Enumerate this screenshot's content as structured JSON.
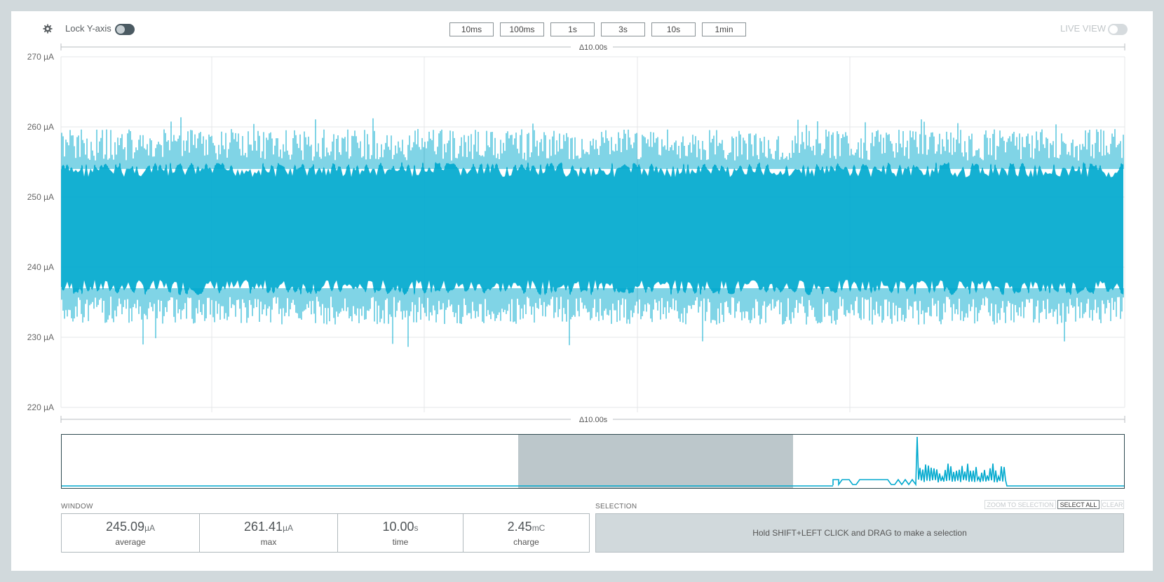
{
  "toolbar": {
    "lock_label": "Lock Y-axis",
    "live_label": "LIVE VIEW",
    "window_buttons": [
      "10ms",
      "100ms",
      "1s",
      "3s",
      "10s",
      "1min"
    ]
  },
  "chart_data": {
    "type": "line",
    "ylim": [
      220,
      270
    ],
    "y_ticks": [
      "220 µA",
      "230 µA",
      "240 µA",
      "250 µA",
      "260 µA",
      "270 µA"
    ],
    "window_span_label": "Δ10.00s",
    "series": [
      {
        "center": 245.09,
        "band_low": 236,
        "band_high": 255,
        "min": 228,
        "max": 261.41
      }
    ],
    "color": "#00a9ce"
  },
  "window": {
    "label": "WINDOW",
    "stats": [
      {
        "value": "245.09",
        "unit": "µA",
        "label": "average"
      },
      {
        "value": "261.41",
        "unit": "µA",
        "label": "max"
      },
      {
        "value": "10.00",
        "unit": "s",
        "label": "time"
      },
      {
        "value": "2.45",
        "unit": "mC",
        "label": "charge"
      }
    ]
  },
  "selection": {
    "label": "SELECTION",
    "buttons": [
      "ZOOM TO SELECTION",
      "SELECT ALL",
      "CLEAR"
    ],
    "hint": "Hold SHIFT+LEFT CLICK and DRAG to make a selection"
  },
  "colors": {
    "accent": "#00a9ce",
    "minimap_window": "#bcc7cb",
    "selection_bg": "#d1d9dc"
  }
}
